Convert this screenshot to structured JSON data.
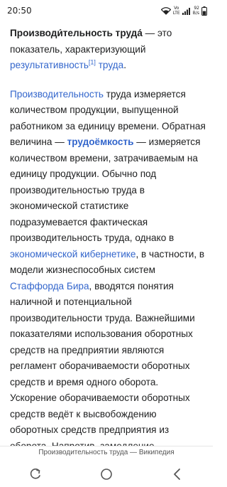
{
  "status_bar": {
    "time": "20:50",
    "network_top": "Vo",
    "network_bottom": "LTE",
    "speed_value": "92",
    "speed_unit": "B/s",
    "battery_level": 0.55
  },
  "article": {
    "p1": {
      "term": "Производи́тельность труда́",
      "dash_text": " — это показатель, характеризующий ",
      "link1": "результативность",
      "footnote": "[1]",
      "space": " ",
      "link2": "труда",
      "end": "."
    },
    "p2": {
      "link_start": "Производительность",
      "t1": " труда измеряется количеством продукции, выпущенной работником за единицу времени. Обратная величина — ",
      "link_bold": "трудоёмкость",
      "t2": " — измеряется количеством времени, затрачиваемым на единицу продукции. Обычно под производительностью труда в экономической статистике подразумевается фактическая производительность труда, однако в ",
      "link_cyber": "экономической кибернетике",
      "t3": ", в частности, в модели жизнеспособных систем ",
      "link_beer": "Стаффорда Бира",
      "t4": ", вводятся понятия наличной и потенциальной производительности труда. Важнейшими показателями использования оборотных средств на предприятии являются регламент оборачиваемости оборотных средств и время одного оборота. Ускорение оборачиваемости оборотных средств ведёт к высвобождению оборотных средств предприятия из оборота. Напротив, замедление"
    }
  },
  "footer": {
    "page_title": "Производительность труда — Википедия"
  }
}
